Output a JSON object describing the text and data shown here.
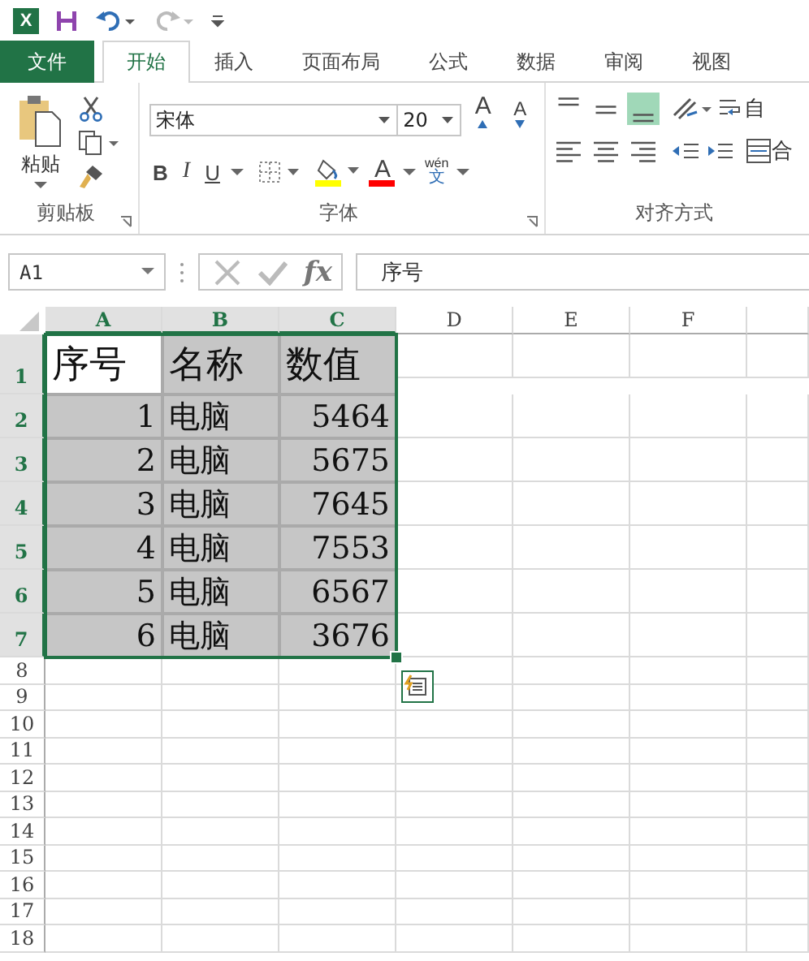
{
  "app_icon": "X",
  "tabs": [
    {
      "label": "文件",
      "kind": "file",
      "selected": false
    },
    {
      "label": "开始",
      "kind": "tab",
      "selected": true
    },
    {
      "label": "插入",
      "kind": "tab",
      "selected": false
    },
    {
      "label": "页面布局",
      "kind": "tab",
      "selected": false
    },
    {
      "label": "公式",
      "kind": "tab",
      "selected": false
    },
    {
      "label": "数据",
      "kind": "tab",
      "selected": false
    },
    {
      "label": "审阅",
      "kind": "tab",
      "selected": false
    },
    {
      "label": "视图",
      "kind": "tab",
      "selected": false
    }
  ],
  "clipboard": {
    "paste_label": "粘贴",
    "group_label": "剪贴板"
  },
  "font": {
    "name": "宋体",
    "size": "20",
    "grow": "A",
    "shrink": "A",
    "bold": "B",
    "italic": "I",
    "underline": "U",
    "font_color": "A",
    "phonetic": "wén",
    "phonetic_char": "文",
    "group_label": "字体"
  },
  "alignment": {
    "vertical": [
      {
        "kind": "top",
        "selected": false
      },
      {
        "kind": "middle",
        "selected": false
      },
      {
        "kind": "bottom",
        "selected": true
      }
    ],
    "horizontal": [
      {
        "kind": "left",
        "selected": false
      },
      {
        "kind": "center",
        "selected": false
      },
      {
        "kind": "right",
        "selected": false
      }
    ],
    "wrap_label": "自",
    "merge_label": "合",
    "group_label": "对齐方式"
  },
  "formula_bar": {
    "name_box": "A1",
    "fx": "fx",
    "formula": "序号"
  },
  "columns": [
    {
      "label": "A",
      "selected": true
    },
    {
      "label": "B",
      "selected": true
    },
    {
      "label": "C",
      "selected": true
    },
    {
      "label": "D",
      "selected": false
    },
    {
      "label": "E",
      "selected": false
    },
    {
      "label": "F",
      "selected": false
    }
  ],
  "rows": [
    {
      "header": "1",
      "selected": true,
      "cells": [
        {
          "text": "序号",
          "kind": "heading",
          "selected": true,
          "active": true
        },
        {
          "text": "名称",
          "kind": "heading",
          "selected": true,
          "active": false
        },
        {
          "text": "数值",
          "kind": "heading",
          "selected": true,
          "active": false
        }
      ]
    },
    {
      "header": "2",
      "selected": true,
      "cells": [
        {
          "text": "1",
          "kind": "number",
          "selected": true,
          "active": false
        },
        {
          "text": "电脑",
          "kind": "text",
          "selected": true,
          "active": false
        },
        {
          "text": "5464",
          "kind": "number",
          "selected": true,
          "active": false
        }
      ]
    },
    {
      "header": "3",
      "selected": true,
      "cells": [
        {
          "text": "2",
          "kind": "number",
          "selected": true,
          "active": false
        },
        {
          "text": "电脑",
          "kind": "text",
          "selected": true,
          "active": false
        },
        {
          "text": "5675",
          "kind": "number",
          "selected": true,
          "active": false
        }
      ]
    },
    {
      "header": "4",
      "selected": true,
      "cells": [
        {
          "text": "3",
          "kind": "number",
          "selected": true,
          "active": false
        },
        {
          "text": "电脑",
          "kind": "text",
          "selected": true,
          "active": false
        },
        {
          "text": "7645",
          "kind": "number",
          "selected": true,
          "active": false
        }
      ]
    },
    {
      "header": "5",
      "selected": true,
      "cells": [
        {
          "text": "4",
          "kind": "number",
          "selected": true,
          "active": false
        },
        {
          "text": "电脑",
          "kind": "text",
          "selected": true,
          "active": false
        },
        {
          "text": "7553",
          "kind": "number",
          "selected": true,
          "active": false
        }
      ]
    },
    {
      "header": "6",
      "selected": true,
      "cells": [
        {
          "text": "5",
          "kind": "number",
          "selected": true,
          "active": false
        },
        {
          "text": "电脑",
          "kind": "text",
          "selected": true,
          "active": false
        },
        {
          "text": "6567",
          "kind": "number",
          "selected": true,
          "active": false
        }
      ]
    },
    {
      "header": "7",
      "selected": true,
      "cells": [
        {
          "text": "6",
          "kind": "number",
          "selected": true,
          "active": false
        },
        {
          "text": "电脑",
          "kind": "text",
          "selected": true,
          "active": false
        },
        {
          "text": "3676",
          "kind": "number",
          "selected": true,
          "active": false
        }
      ]
    },
    {
      "header": "8",
      "selected": false,
      "cells": []
    },
    {
      "header": "9",
      "selected": false,
      "cells": []
    },
    {
      "header": "10",
      "selected": false,
      "cells": []
    },
    {
      "header": "11",
      "selected": false,
      "cells": []
    },
    {
      "header": "12",
      "selected": false,
      "cells": []
    },
    {
      "header": "13",
      "selected": false,
      "cells": []
    },
    {
      "header": "14",
      "selected": false,
      "cells": []
    },
    {
      "header": "15",
      "selected": false,
      "cells": []
    },
    {
      "header": "16",
      "selected": false,
      "cells": []
    },
    {
      "header": "17",
      "selected": false,
      "cells": []
    },
    {
      "header": "18",
      "selected": false,
      "cells": []
    }
  ]
}
